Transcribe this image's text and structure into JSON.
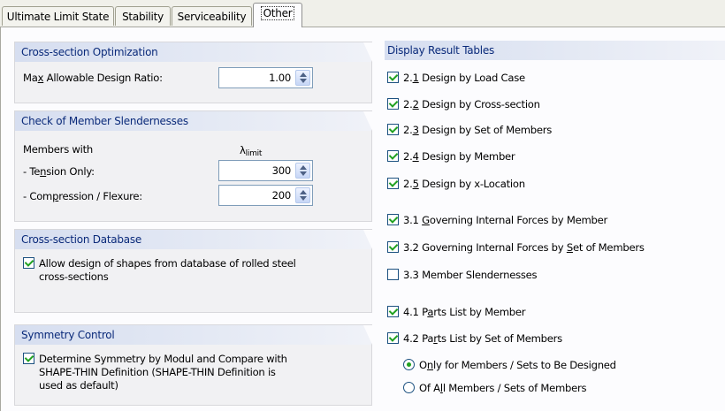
{
  "tabs": [
    "Ultimate Limit State",
    "Stability",
    "Serviceability",
    "Other"
  ],
  "optimization": {
    "title": "Cross-section Optimization",
    "label_pre": "Ma",
    "label_u": "x",
    "label_post": " Allowable Design Ratio:",
    "value": "1.00"
  },
  "slenderness": {
    "title": "Check of Member Slendernesses",
    "members_with": "Members with",
    "lambda": "λ",
    "limit": "limit",
    "tension_pre": "- Te",
    "tension_u": "n",
    "tension_post": "sion Only:",
    "tension_value": "300",
    "compression_pre": "- Com",
    "compression_u": "p",
    "compression_post": "ression / Flexure:",
    "compression_value": "200"
  },
  "database": {
    "title": "Cross-section Database",
    "option_line1": "Allow design of shapes from database of rolled steel",
    "option_line2": "cross-sections",
    "checked": true
  },
  "symmetry": {
    "title": "Symmetry Control",
    "option_line1": "Determine Symmetry by Modul and Compare with",
    "option_line2": "SHAPE-THIN Definition (SHAPE-THIN Definition is",
    "option_line3": "used as default)",
    "checked": true
  },
  "results": {
    "title": "Display Result Tables",
    "items": [
      {
        "pre": "2.",
        "u": "1",
        "post": " Design by Load Case",
        "checked": true
      },
      {
        "pre": "2.",
        "u": "2",
        "post": " Design by Cross-section",
        "checked": true
      },
      {
        "pre": "2.",
        "u": "3",
        "post": " Design by Set of Members",
        "checked": true
      },
      {
        "pre": "2.",
        "u": "4",
        "post": " Design by Member",
        "checked": true
      },
      {
        "pre": "2.",
        "u": "5",
        "post": " Design by x-Location",
        "checked": true
      },
      {
        "pre": "3.1 ",
        "u": "G",
        "post": "overning Internal Forces by Member",
        "checked": true
      },
      {
        "pre": "3.2 Governing Internal Forces by ",
        "u": "S",
        "post": "et of Members",
        "checked": true
      },
      {
        "pre": "3.3 Member Slendernesses",
        "u": "",
        "post": "",
        "checked": false
      },
      {
        "pre": "4.1 P",
        "u": "a",
        "post": "rts List by Member",
        "checked": true
      },
      {
        "pre": "4.2 Pa",
        "u": "r",
        "post": "ts List by Set of Members",
        "checked": true
      }
    ],
    "radio1_pre": "O",
    "radio1_u": "n",
    "radio1_post": "ly for Members / Sets to Be Designed",
    "radio2_pre": "Of A",
    "radio2_u": "l",
    "radio2_post": "l Members / Sets of Members"
  }
}
